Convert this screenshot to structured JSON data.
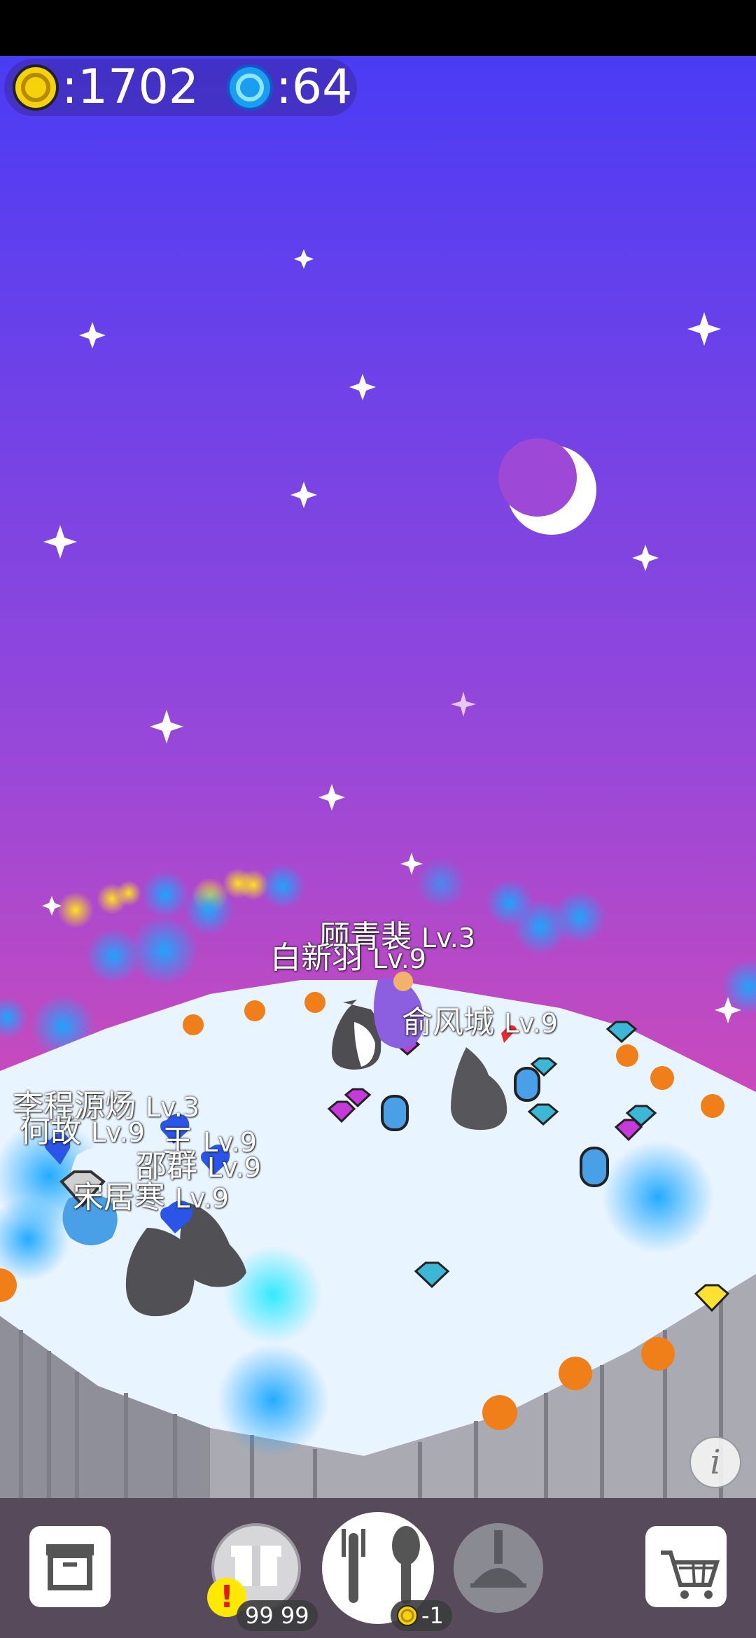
{
  "hud": {
    "coins": ":1702",
    "gems": ":64",
    "coin_icon": "gold-coin-icon",
    "gem_icon": "blue-gem-icon"
  },
  "characters": [
    {
      "name": "顾青裴",
      "level": "Lv.3"
    },
    {
      "name": "白新羽",
      "level": "Lv.9"
    },
    {
      "name": "俞风城",
      "level": "Lv.9"
    },
    {
      "name": "李程源炀",
      "level": "Lv.3"
    },
    {
      "name": "何故",
      "level": "Lv.9"
    },
    {
      "name": "王",
      "level": "Lv.9"
    },
    {
      "name": "邵群",
      "level": "Lv.9"
    },
    {
      "name": "宋居寒",
      "level": "Lv.9"
    }
  ],
  "toolbar": {
    "gift_count": "99 99",
    "feed_cost": "-1",
    "alert": "!",
    "info": "i"
  },
  "colors": {
    "sky_top": "#4a3cf5",
    "sky_bottom": "#e33aa8",
    "island": "#e8f4ff"
  }
}
